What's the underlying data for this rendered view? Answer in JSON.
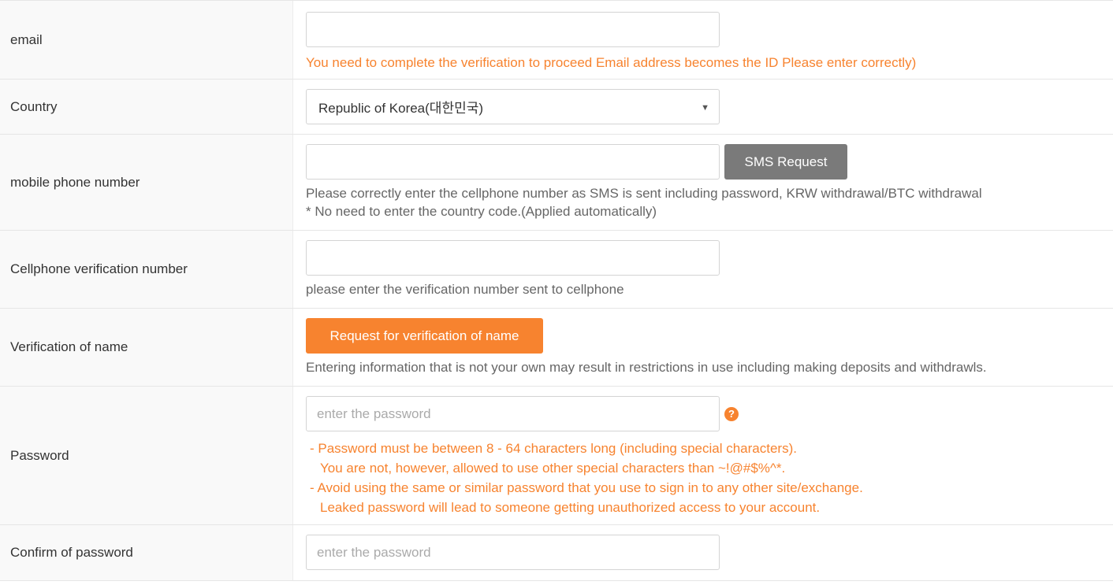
{
  "email": {
    "label": "email",
    "value": "",
    "note": "You need to complete the verification to proceed Email address becomes the ID Please enter correctly)"
  },
  "country": {
    "label": "Country",
    "selected": "Republic of Korea(대한민국)",
    "caret": "▼"
  },
  "mobile": {
    "label": "mobile phone number",
    "value": "",
    "button": "SMS Request",
    "note1": "Please correctly enter the cellphone number as SMS is sent including password, KRW withdrawal/BTC withdrawal",
    "note2": "* No need to enter the country code.(Applied automatically)"
  },
  "verify_code": {
    "label": "Cellphone verification number",
    "value": "",
    "note": "please enter the verification number sent to cellphone"
  },
  "name_verify": {
    "label": "Verification of name",
    "button": "Request for verification of name",
    "note": "Entering information that is not your own may result in restrictions in use including making deposits and withdrawls."
  },
  "password": {
    "label": "Password",
    "placeholder": "enter the password",
    "help_glyph": "?",
    "rules": [
      "- Password must be between 8 - 64 characters long (including special characters).",
      "You are not, however, allowed to use other special characters than ~!@#$%^*.",
      "- Avoid using the same or similar password that you use to sign in to any other site/exchange.",
      "Leaked password will lead to someone getting unauthorized access to your account."
    ]
  },
  "confirm_password": {
    "label": "Confirm of password",
    "placeholder": "enter the password"
  },
  "colors": {
    "accent": "#f7832f",
    "button_gray": "#7a7a7a",
    "label_bg": "#f9f9f9",
    "border": "#e6e6e6"
  }
}
